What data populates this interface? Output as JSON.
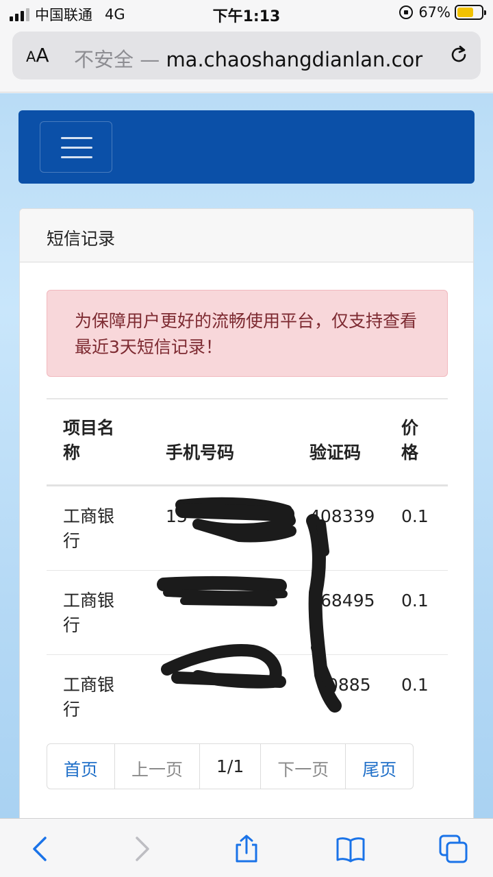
{
  "status_bar": {
    "carrier": "中国联通",
    "network": "4G",
    "time": "下午1:13",
    "battery": "67%",
    "battery_level": 0.67
  },
  "browser": {
    "aa_label": "AA",
    "insecure_label": "不安全 —",
    "url": "ma.chaoshangdianlan.cor"
  },
  "card": {
    "title": "短信记录",
    "alert": "为保障用户更好的流畅使用平台，仅支持查看最近3天短信记录！"
  },
  "table": {
    "headers": [
      "项目名称",
      "手机号码",
      "验证码",
      "价格"
    ],
    "rows": [
      {
        "project": "工商银行",
        "phone": "13",
        "code": "408339",
        "price": "0.1"
      },
      {
        "project": "工商银行",
        "phone": "",
        "code": "68495",
        "price": "0.1"
      },
      {
        "project": "工商银行",
        "phone": "",
        "code": "0885",
        "price": "0.1"
      }
    ]
  },
  "pagination": {
    "first": "首页",
    "prev": "上一页",
    "current": "1/1",
    "next": "下一页",
    "last": "尾页"
  }
}
